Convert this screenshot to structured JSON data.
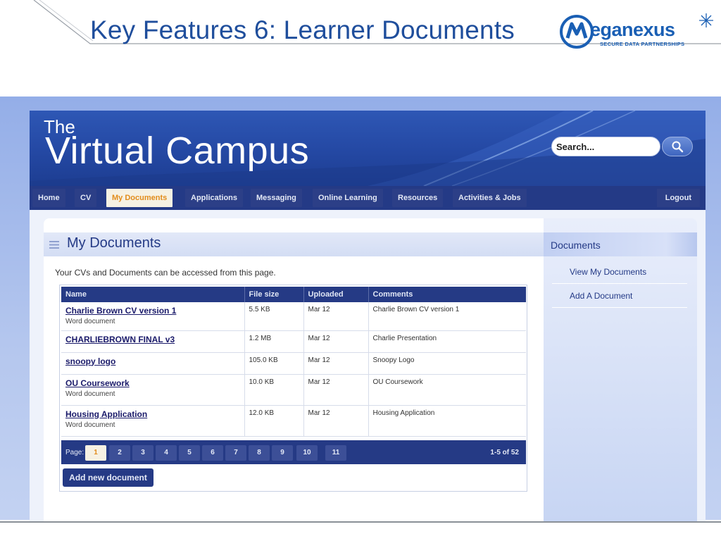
{
  "slide": {
    "title": "Key Features 6: Learner Documents",
    "logo": {
      "word": "Meganexus",
      "tagline": "SECURE DATA PARTNERSHIPS"
    }
  },
  "site": {
    "brand": {
      "the": "The",
      "main": "Virtual Campus"
    },
    "search": {
      "placeholder": "Search..."
    },
    "nav": {
      "items": [
        {
          "label": "Home",
          "active": false
        },
        {
          "label": "CV",
          "active": false
        },
        {
          "label": "My Documents",
          "active": true
        },
        {
          "label": "Applications",
          "active": false
        },
        {
          "label": "Messaging",
          "active": false
        },
        {
          "label": "Online Learning",
          "active": false
        },
        {
          "label": "Resources",
          "active": false
        },
        {
          "label": "Activities & Jobs",
          "active": false
        }
      ],
      "logout": "Logout"
    },
    "content": {
      "title": "My Documents",
      "intro": "Your CVs and Documents can be accessed from this page.",
      "table": {
        "headers": [
          "Name",
          "File size",
          "Uploaded",
          "Comments"
        ],
        "rows": [
          {
            "name": "Charlie Brown CV version 1",
            "type": "Word document",
            "size": "5.5 KB",
            "uploaded": "Mar 12",
            "comments": "Charlie Brown CV version 1"
          },
          {
            "name": "CHARLIEBROWN FINAL v3",
            "type": "",
            "size": "1.2 MB",
            "uploaded": "Mar 12",
            "comments": "Charlie Presentation"
          },
          {
            "name": "snoopy logo",
            "type": "",
            "size": "105.0 KB",
            "uploaded": "Mar 12",
            "comments": "Snoopy Logo"
          },
          {
            "name": "OU Coursework",
            "type": "Word document",
            "size": "10.0 KB",
            "uploaded": "Mar 12",
            "comments": "OU Coursework"
          },
          {
            "name": "Housing Application",
            "type": "Word document",
            "size": "12.0 KB",
            "uploaded": "Mar 12",
            "comments": "Housing Application"
          }
        ]
      },
      "pager": {
        "label": "Page:",
        "pages": [
          "1",
          "2",
          "3",
          "4",
          "5",
          "6",
          "7",
          "8",
          "9",
          "10",
          "11"
        ],
        "current": "1",
        "count": "1-5 of 52"
      },
      "add_button": "Add new document"
    },
    "sidebar": {
      "title": "Documents",
      "links": [
        "View My Documents",
        "Add A Document"
      ]
    }
  },
  "colors": {
    "slide_title": "#1f4e9c",
    "banner": "#2448a3",
    "nav_bar": "#243a86",
    "active_tab_text": "#e28c1c",
    "table_header": "#253a85"
  }
}
